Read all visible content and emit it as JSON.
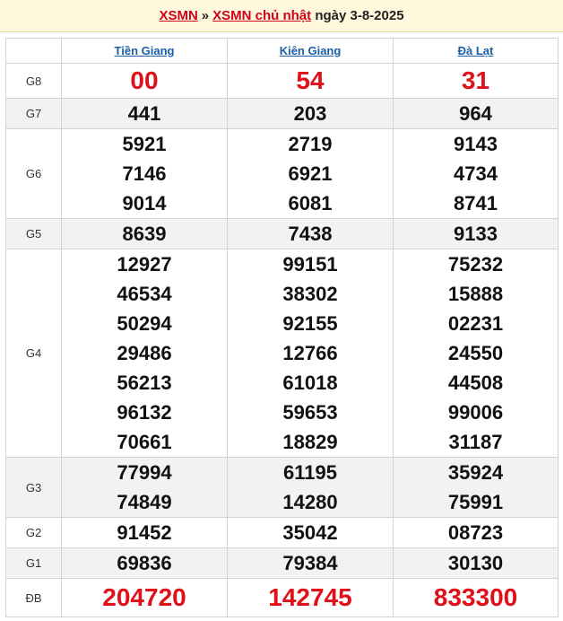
{
  "header": {
    "link1": "XSMN",
    "separator": "»",
    "link2": "XSMN chủ nhật",
    "date_text": "ngày 3-8-2025"
  },
  "provinces": [
    "Tiền Giang",
    "Kiên Giang",
    "Đà Lạt"
  ],
  "prizes": [
    {
      "label": "G8",
      "style": "big",
      "values": [
        [
          "00"
        ],
        [
          "54"
        ],
        [
          "31"
        ]
      ]
    },
    {
      "label": "G7",
      "style": "num",
      "values": [
        [
          "441"
        ],
        [
          "203"
        ],
        [
          "964"
        ]
      ]
    },
    {
      "label": "G6",
      "style": "num",
      "values": [
        [
          "5921",
          "7146",
          "9014"
        ],
        [
          "2719",
          "6921",
          "6081"
        ],
        [
          "9143",
          "4734",
          "8741"
        ]
      ]
    },
    {
      "label": "G5",
      "style": "num",
      "values": [
        [
          "8639"
        ],
        [
          "7438"
        ],
        [
          "9133"
        ]
      ]
    },
    {
      "label": "G4",
      "style": "num",
      "values": [
        [
          "12927",
          "46534",
          "50294",
          "29486",
          "56213",
          "96132",
          "70661"
        ],
        [
          "99151",
          "38302",
          "92155",
          "12766",
          "61018",
          "59653",
          "18829"
        ],
        [
          "75232",
          "15888",
          "02231",
          "24550",
          "44508",
          "99006",
          "31187"
        ]
      ]
    },
    {
      "label": "G3",
      "style": "num",
      "values": [
        [
          "77994",
          "74849"
        ],
        [
          "61195",
          "14280"
        ],
        [
          "35924",
          "75991"
        ]
      ]
    },
    {
      "label": "G2",
      "style": "num",
      "values": [
        [
          "91452"
        ],
        [
          "35042"
        ],
        [
          "08723"
        ]
      ]
    },
    {
      "label": "G1",
      "style": "num",
      "values": [
        [
          "69836"
        ],
        [
          "79384"
        ],
        [
          "30130"
        ]
      ]
    },
    {
      "label": "ĐB",
      "style": "db",
      "values": [
        [
          "204720"
        ],
        [
          "142745"
        ],
        [
          "833300"
        ]
      ]
    }
  ],
  "colors": {
    "red": "#e0101b",
    "link_blue": "#1a5ea8",
    "header_bg": "#fff8dc",
    "alt_row_bg": "#f2f2f2"
  }
}
